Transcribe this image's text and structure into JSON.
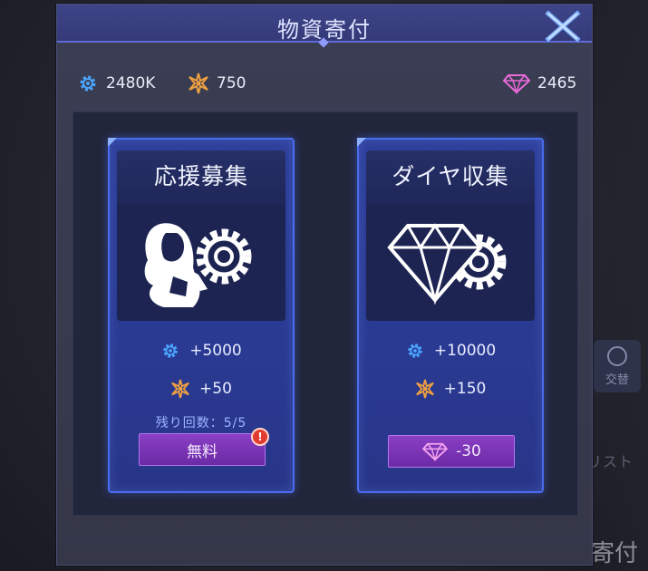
{
  "dialog": {
    "title": "物資寄付"
  },
  "currencies": {
    "gear": {
      "icon": "gear-icon",
      "value": "2480K"
    },
    "star": {
      "icon": "star-burst-icon",
      "value": "750"
    },
    "gem": {
      "icon": "diamond-icon",
      "value": "2465"
    }
  },
  "cards": [
    {
      "title": "応援募集",
      "art": "character-gear-art",
      "rewards": [
        {
          "icon": "gear-icon",
          "amount": "+5000"
        },
        {
          "icon": "star-burst-icon",
          "amount": "+50"
        }
      ],
      "remaining": "残り回数：5/5",
      "button_label": "無料",
      "alert": "!"
    },
    {
      "title": "ダイヤ収集",
      "art": "diamond-gear-art",
      "rewards": [
        {
          "icon": "gear-icon",
          "amount": "+10000"
        },
        {
          "icon": "star-burst-icon",
          "amount": "+150"
        }
      ],
      "button_label": "-30",
      "button_icon": "diamond-icon"
    }
  ],
  "background": {
    "swap_label": "交替",
    "list_label": "リスト",
    "donate_label": "寄付"
  },
  "colors": {
    "accent_blue": "#4b6cf0",
    "button_purple": "#7a34b6",
    "gem_pink": "#e86ad8",
    "star_orange": "#f0a040",
    "gear_blue": "#4aa6ff"
  }
}
